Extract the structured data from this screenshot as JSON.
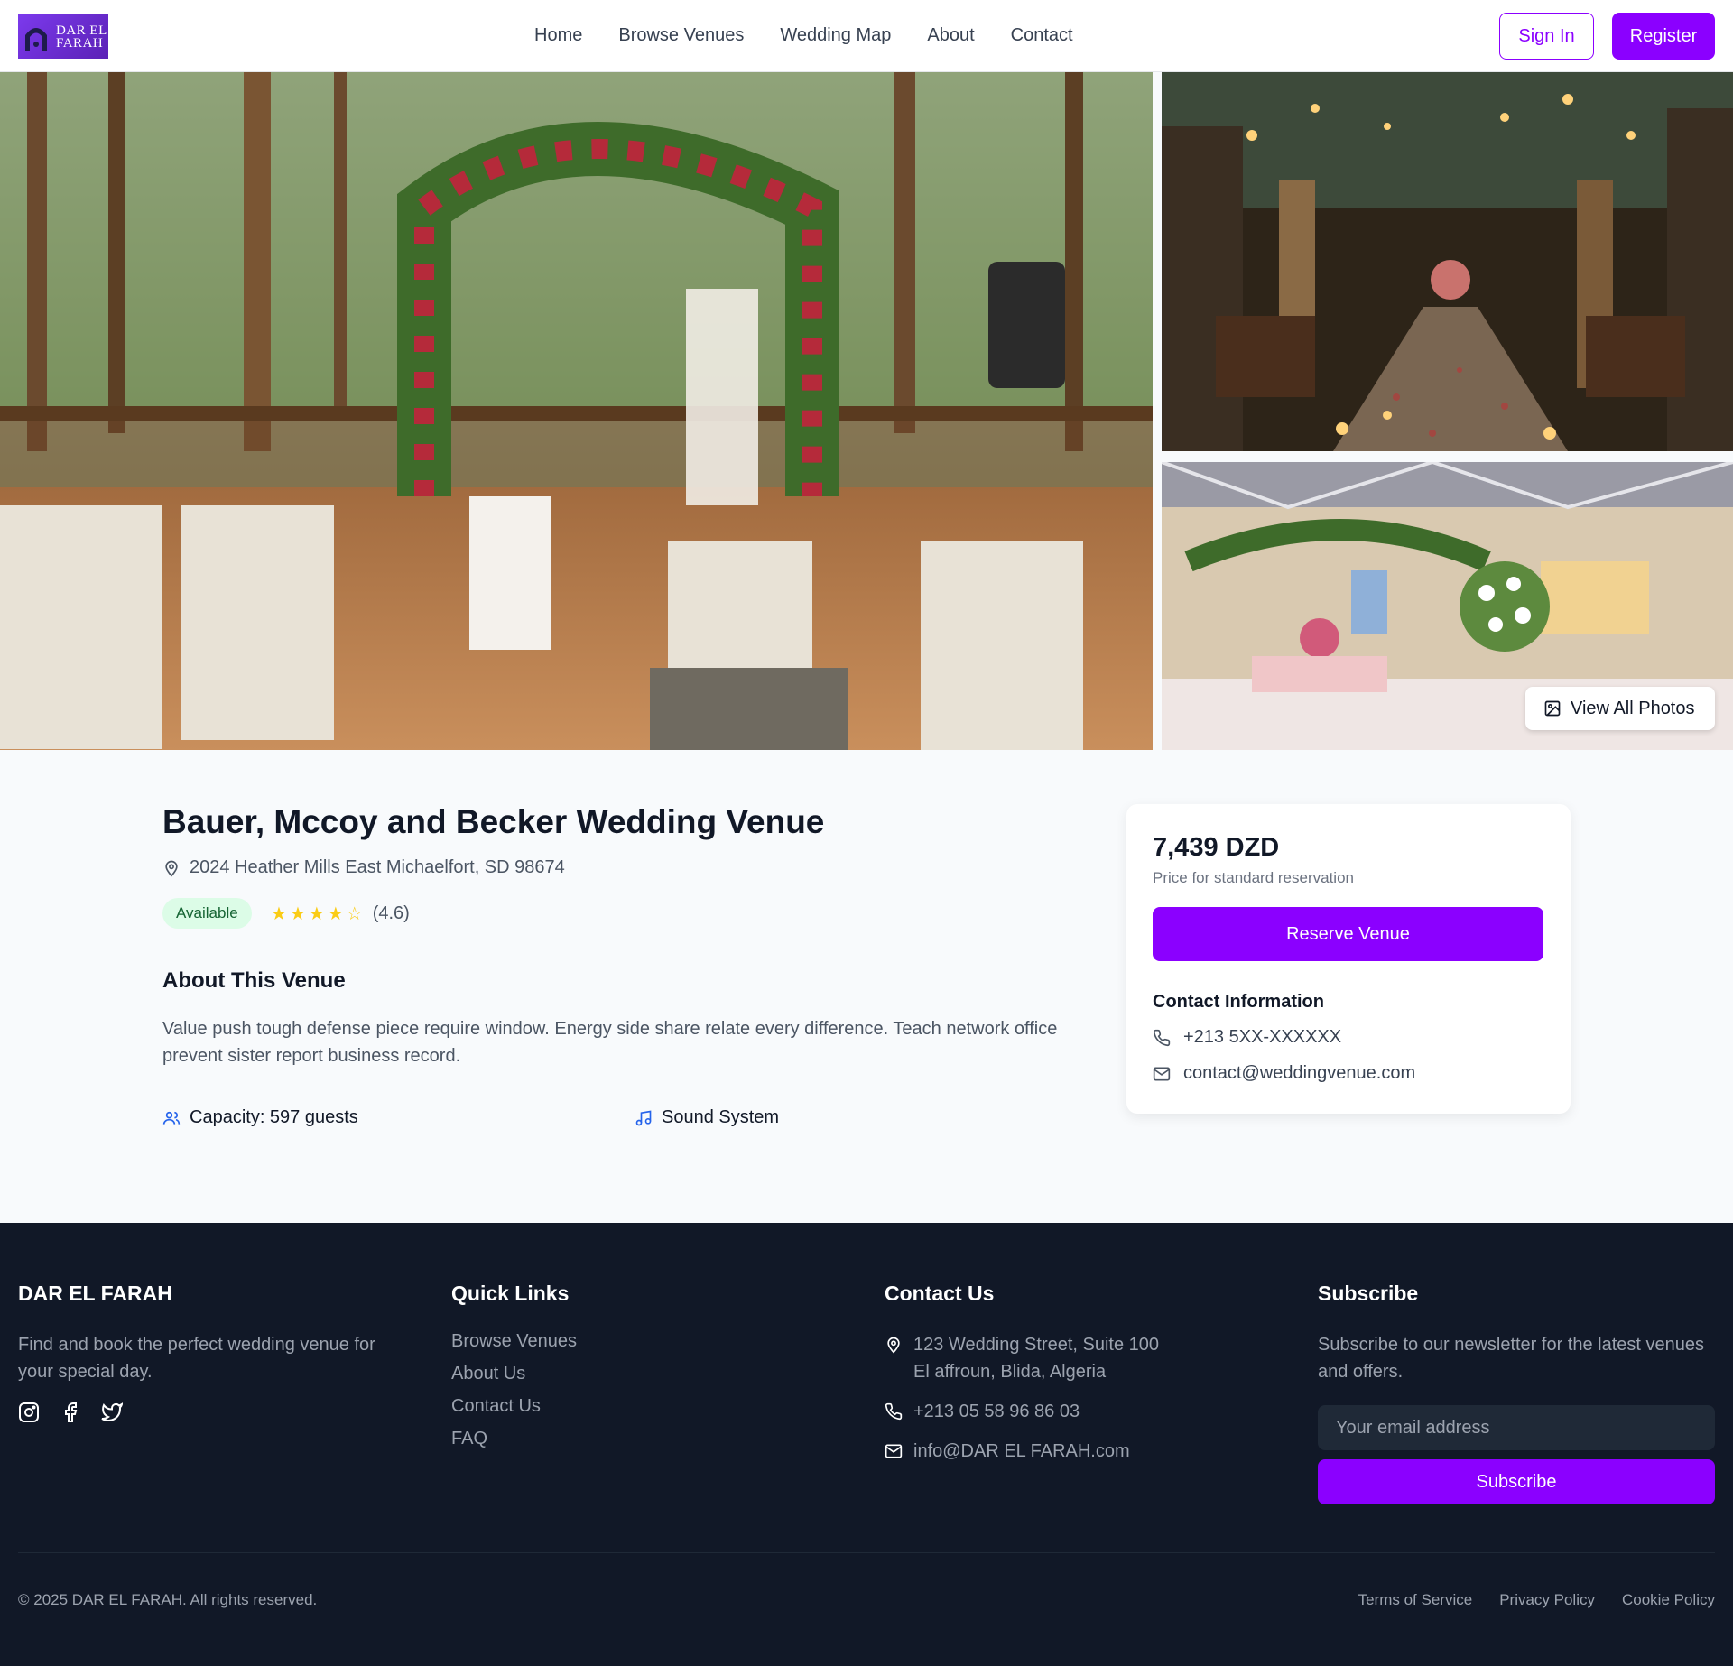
{
  "brand": {
    "logo_text_line1": "DAR EL",
    "logo_text_line2": "FARAH",
    "name": "DAR EL FARAH"
  },
  "nav": {
    "links": [
      "Home",
      "Browse Venues",
      "Wedding Map",
      "About",
      "Contact"
    ],
    "sign_in": "Sign In",
    "register": "Register"
  },
  "gallery": {
    "view_all": "View All Photos"
  },
  "venue": {
    "title": "Bauer, Mccoy and Becker Wedding Venue",
    "address": "2024 Heather Mills East Michaelfort, SD 98674",
    "status": "Available",
    "rating": 4.6,
    "rating_text": "(4.6)",
    "about_heading": "About This Venue",
    "about_text": "Value push tough defense piece require window. Energy side share relate every difference. Teach network office prevent sister report business record.",
    "features": [
      {
        "icon": "users-icon",
        "label": "Capacity: 597 guests"
      },
      {
        "icon": "music-icon",
        "label": "Sound System"
      }
    ]
  },
  "booking": {
    "price": "7,439 DZD",
    "price_note": "Price for standard reservation",
    "reserve_label": "Reserve Venue",
    "contact_heading": "Contact Information",
    "phone": "+213 5XX-XXXXXX",
    "email": "contact@weddingvenue.com"
  },
  "footer": {
    "brand_heading": "DAR EL FARAH",
    "brand_text": "Find and book the perfect wedding venue for your special day.",
    "quick_links_heading": "Quick Links",
    "quick_links": [
      "Browse Venues",
      "About Us",
      "Contact Us",
      "FAQ"
    ],
    "contact_heading": "Contact Us",
    "address_line1": "123 Wedding Street, Suite 100",
    "address_line2": "El affroun, Blida, Algeria",
    "phone": "+213 05 58 96 86 03",
    "email": "info@DAR EL FARAH.com",
    "subscribe_heading": "Subscribe",
    "subscribe_text": "Subscribe to our newsletter for the latest venues and offers.",
    "email_placeholder": "Your email address",
    "subscribe_button": "Subscribe",
    "copyright": "© 2025 DAR EL FARAH. All rights reserved.",
    "legal_links": [
      "Terms of Service",
      "Privacy Policy",
      "Cookie Policy"
    ]
  },
  "colors": {
    "accent": "#8b00ff",
    "footer_bg": "#111827",
    "badge_bg": "#dcfce7",
    "star": "#facc15"
  }
}
